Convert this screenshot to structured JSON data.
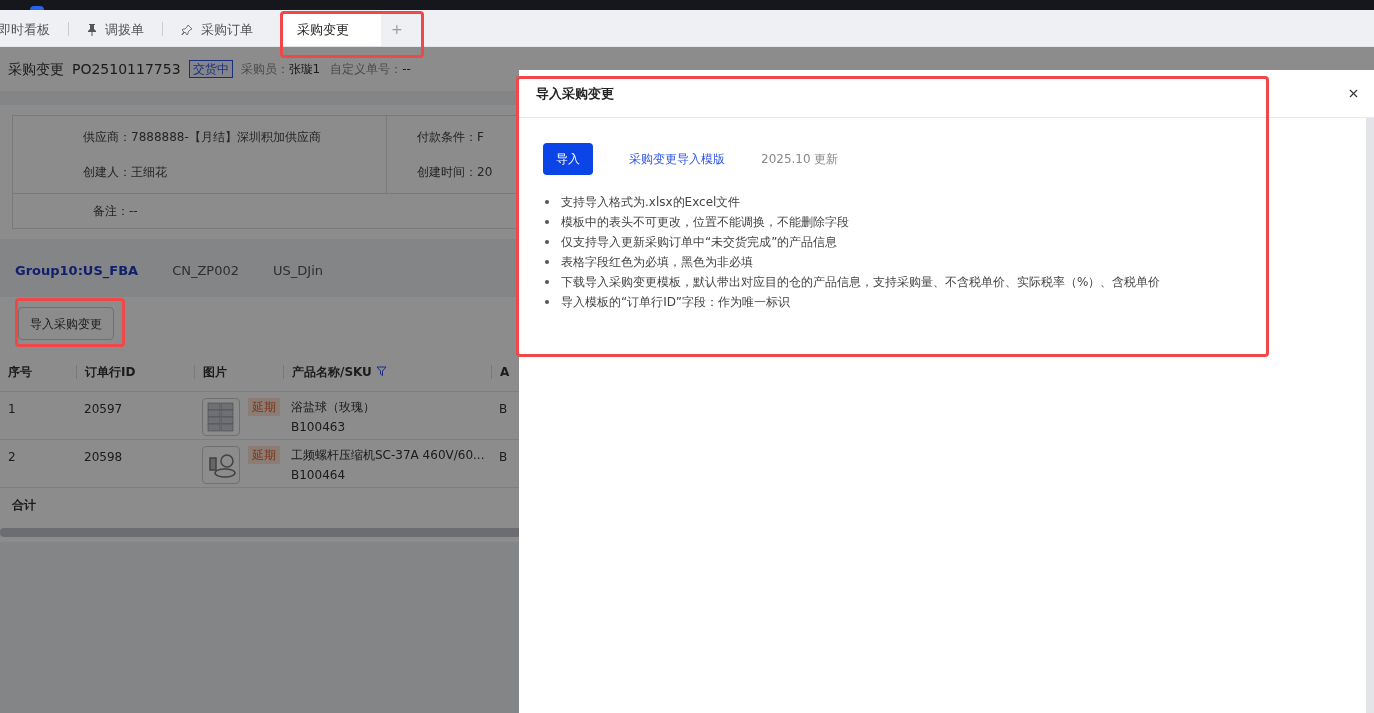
{
  "tabs": [
    {
      "label": "即时看板",
      "kind": "plain",
      "selected": false
    },
    {
      "label": "调拨单",
      "kind": "pinned",
      "selected": false
    },
    {
      "label": "采购订单",
      "kind": "pinnable",
      "selected": false
    },
    {
      "label": "采购变更",
      "kind": "plain",
      "selected": true
    }
  ],
  "add_tab": "+",
  "page": {
    "title": "采购变更",
    "order_no": "PO2510117753",
    "status": "交货中",
    "buyer_label": "采购员：",
    "buyer": "张璇1",
    "custom_no_label": "自定义单号：",
    "custom_no": "--",
    "info_left": [
      "供应商：7888888-【月结】深圳积加供应商",
      "创建人：王细花"
    ],
    "info_right": [
      "付款条件：F",
      "创建时间：20"
    ],
    "remark": "备注：--",
    "groups": [
      {
        "label": "Group10:US_FBA",
        "selected": true
      },
      {
        "label": "CN_ZP002",
        "selected": false
      },
      {
        "label": "US_DJin",
        "selected": false
      }
    ],
    "import_button": "导入采购变更",
    "table": {
      "columns": [
        {
          "label": "序号",
          "filter": false
        },
        {
          "label": "订单行ID",
          "filter": false
        },
        {
          "label": "图片",
          "filter": false
        },
        {
          "label": "产品名称/SKU",
          "filter": true
        },
        {
          "label": "A",
          "filter": false
        }
      ],
      "rows": [
        {
          "no": "1",
          "line_id": "20597",
          "tag": "延期",
          "name": "浴盐球（玫瑰）",
          "sku": "B100463",
          "column_5": "B"
        },
        {
          "no": "2",
          "line_id": "20598",
          "tag": "延期",
          "name": "工频螺杆压缩机SC-37A 460V/60...",
          "sku": "B100464",
          "column_5": "B"
        }
      ],
      "total": "合计"
    }
  },
  "drawer": {
    "title": "导入采购变更",
    "import": "导入",
    "template_link": "采购变更导入模版",
    "update_note": "2025.10 更新",
    "notes": [
      "支持导入格式为.xlsx的Excel文件",
      "模板中的表头不可更改，位置不能调换，不能删除字段",
      "仅支持导入更新采购订单中“未交货完成”的产品信息",
      "表格字段红色为必填，黑色为非必填",
      "下载导入采购变更模板，默认带出对应目的仓的产品信息，支持采购量、不含税单价、实际税率（%）、含税单价",
      "导入模板的“订单行ID”字段：作为唯一标识"
    ]
  }
}
